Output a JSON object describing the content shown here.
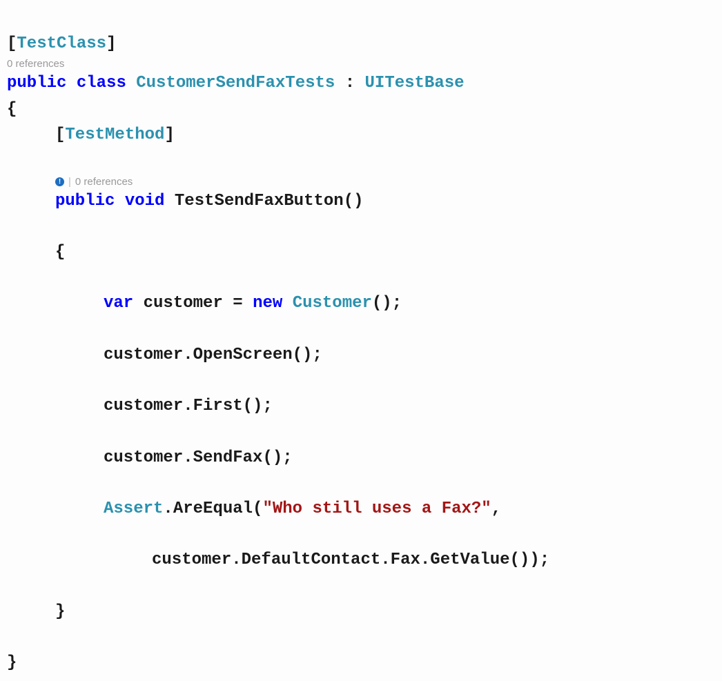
{
  "attribute_class": "TestClass",
  "codelens_class_refs": "0 references",
  "class_decl": {
    "kw_public": "public",
    "kw_class": "class",
    "name": "CustomerSendFaxTests",
    "colon": ":",
    "base": "UITestBase"
  },
  "attribute_method": "TestMethod",
  "codelens_method_refs": "0 references",
  "method_decl": {
    "kw_public": "public",
    "kw_void": "void",
    "name": "TestSendFaxButton"
  },
  "body": {
    "var_kw": "var",
    "var_name": "customer",
    "new_kw": "new",
    "ctor_type": "Customer",
    "call_open": "OpenScreen",
    "call_first": "First",
    "call_sendfax": "SendFax",
    "assert_type": "Assert",
    "assert_method": "AreEqual",
    "string_literal": "\"Who still uses a Fax?\"",
    "prop_defaultcontact": "DefaultContact",
    "prop_fax": "Fax",
    "call_getvalue": "GetValue"
  }
}
